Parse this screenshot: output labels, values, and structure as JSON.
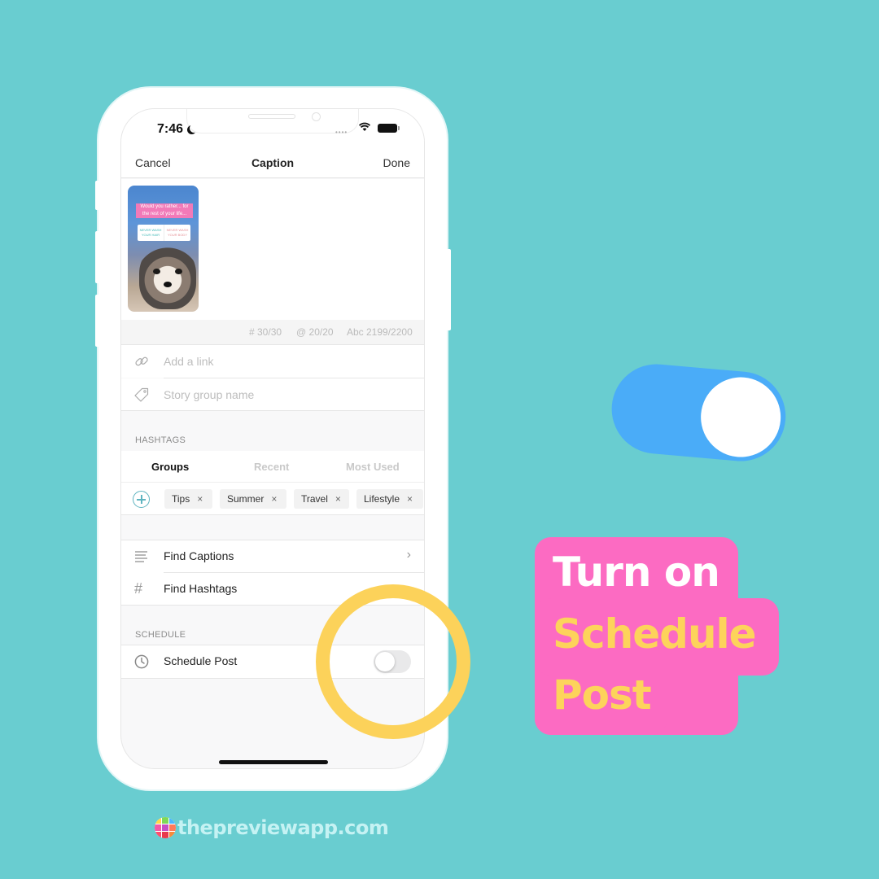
{
  "status_bar": {
    "time": "7:46"
  },
  "navbar": {
    "cancel_label": "Cancel",
    "title": "Caption",
    "done_label": "Done"
  },
  "post_preview": {
    "question_text": "Would you rather... for the rest of your life...",
    "option_1": "NEVER WASH YOUR HAIR",
    "option_2": "NEVER WASH YOUR BODY"
  },
  "counters": {
    "hashtags": "# 30/30",
    "mentions": "@ 20/20",
    "characters": "Abc 2199/2200"
  },
  "fields": {
    "link_placeholder": "Add a link",
    "story_group_placeholder": "Story group name"
  },
  "hashtags": {
    "section_label": "HASHTAGS",
    "tabs": [
      {
        "label": "Groups",
        "active": true
      },
      {
        "label": "Recent",
        "active": false
      },
      {
        "label": "Most Used",
        "active": false
      }
    ],
    "chips": [
      {
        "label": "Tips",
        "remove": "×"
      },
      {
        "label": "Summer",
        "remove": "×"
      },
      {
        "label": "Travel",
        "remove": "×"
      },
      {
        "label": "Lifestyle",
        "remove": "×"
      }
    ]
  },
  "menu": {
    "find_captions": "Find Captions",
    "find_hashtags": "Find Hashtags",
    "chevron": "›"
  },
  "schedule": {
    "section_label": "SCHEDULE",
    "schedule_post_label": "Schedule Post",
    "toggle_on": false
  },
  "callout": {
    "line1": "Turn on",
    "line2": "Schedule",
    "line3": "Post"
  },
  "brand": {
    "text": "thepreviewapp.com"
  },
  "colors": {
    "background": "#69cdd0",
    "callout_pink": "#fc6bc2",
    "callout_yellow": "#fdd35b",
    "ring_yellow": "#fcd25a",
    "toggle_blue": "#4aacf8",
    "add_button_teal": "#5fb4c0"
  }
}
